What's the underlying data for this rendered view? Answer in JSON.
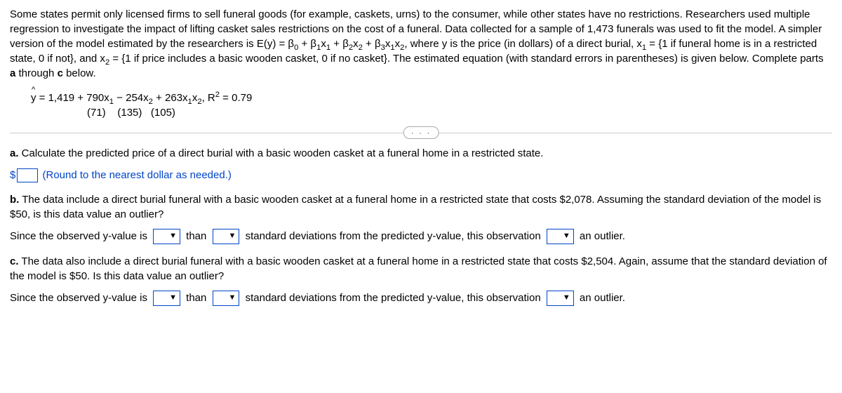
{
  "intro": {
    "p1a": "Some states permit only licensed firms to sell funeral goods (for example, caskets, urns) to the consumer, while other states have no restrictions. Researchers used multiple regression to investigate the impact of lifting casket sales restrictions on the cost of a funeral. Data collected for a sample of 1,473 funerals was used to fit the model. A simpler version of the model estimated by the researchers is E(y) = β",
    "sub0": "0",
    "p1b": " + β",
    "sub1": "1",
    "p1c": "x",
    "p1d": " + β",
    "sub2": "2",
    "p1e": "x",
    "p1f": " + β",
    "sub3": "3",
    "p1g": "x",
    "p1h": "x",
    "p1i": ", where y is the price (in dollars) of a direct burial, x",
    "p1j": " = {1 if funeral home is in a restricted state, 0 if not}, and x",
    "p1k": " = {1 if price includes a basic wooden casket, 0 if no casket}. The estimated equation (with standard errors in parentheses) is given below. Complete parts ",
    "bolda": "a",
    "p1l": " through ",
    "boldc": "c",
    "p1m": " below."
  },
  "equation": {
    "lhs_y": "y",
    "eq": " = 1,419 + 790x",
    "s1": "1",
    "t2": " − 254x",
    "s2": "2",
    "t3": " + 263x",
    "s3a": "1",
    "t3b": "x",
    "s3b": "2",
    "r2a": ", R",
    "r2sup": "2",
    "r2b": " = 0.79",
    "se1": "(71)",
    "se2": "(135)",
    "se3": "(105)"
  },
  "dots": "· · ·",
  "a": {
    "label": "a.",
    "text": " Calculate the predicted price of a direct burial with a basic wooden casket at a funeral home in a restricted state.",
    "dollar": "$",
    "hint": "(Round to the nearest dollar as needed.)"
  },
  "b": {
    "label": "b.",
    "text": " The data include a direct burial funeral with a basic wooden casket at a funeral home in a restricted state that costs $2,078. Assuming the standard deviation of the model is $50, is this data value an outlier?",
    "row_a": "Since the observed y-value is ",
    "than": " than ",
    "row_b": " standard deviations from the predicted y-value, this observation ",
    "row_c": " an outlier."
  },
  "c": {
    "label": "c.",
    "text": " The data also include a direct burial funeral with a basic wooden casket at a funeral home in a restricted state that costs $2,504. Again, assume that the standard deviation of the model is $50. Is this data value an outlier?",
    "row_a": "Since the observed y-value is ",
    "than": " than ",
    "row_b": " standard deviations from the predicted y-value, this observation ",
    "row_c": " an outlier."
  }
}
